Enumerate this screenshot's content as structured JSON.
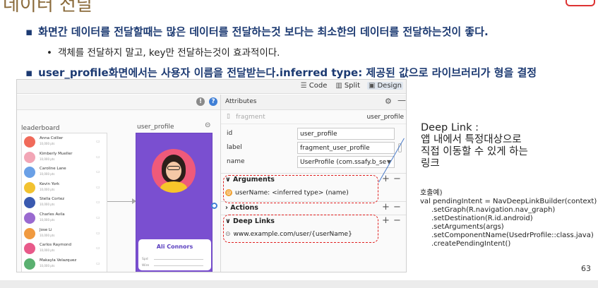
{
  "slide": {
    "title": "데이터 전달",
    "bullet1": "화면간 데이터를 전달할때는 많은 데이터를 전달하는것 보다는 최소한의 데이터를 전달하는것이 좋다.",
    "bullet2": "객체를 전달하지 말고, key만 전달하는것이 효과적이다.",
    "bullet3": "user_profile화면에서는 사용자 이름을 전달받는다.inferred type: 제공된 값으로 라이브러리가 형을 결정",
    "page_number": "63",
    "colors": {
      "heading": "#1c3a72",
      "title": "#8a6a3a",
      "highlight": "#e02020"
    }
  },
  "editor": {
    "modes": [
      "Code",
      "Split",
      "Design"
    ],
    "active_mode": "Design",
    "canvas": {
      "leaderboard_label": "leaderboard",
      "user_profile_label": "user_profile",
      "contacts": [
        {
          "name": "Anna Collier",
          "meta": "10,000 pts",
          "color": "#f06a5a"
        },
        {
          "name": "Kimberly Mueller",
          "meta": "10,000 pts",
          "color": "#f2a6b6"
        },
        {
          "name": "Caroline Lane",
          "meta": "10,000 pts",
          "color": "#6aa0e6"
        },
        {
          "name": "Kevin York",
          "meta": "10,000 pts",
          "color": "#f2c230"
        },
        {
          "name": "Stella Cortez",
          "meta": "10,000 pts",
          "color": "#3a5ab0"
        },
        {
          "name": "Charles Avila",
          "meta": "10,000 pts",
          "color": "#9a6ad0"
        },
        {
          "name": "Jose Li",
          "meta": "10,000 pts",
          "color": "#f09a40"
        },
        {
          "name": "Carlos Raymond",
          "meta": "10,000 pts",
          "color": "#e85a8a"
        },
        {
          "name": "Makayla Velazquez",
          "meta": "10,000 pts",
          "color": "#5ab070"
        }
      ],
      "profile_card": {
        "name": "Ali Connors",
        "row1": "Spd",
        "row2": "Wire"
      }
    },
    "attributes": {
      "panel_title": "Attributes",
      "fragment_label": "fragment",
      "fragment_id": "user_profile",
      "fields": [
        {
          "key": "id",
          "value": "user_profile"
        },
        {
          "key": "label",
          "value": "fragment_user_profile"
        },
        {
          "key": "name",
          "value": "UserProfile (com.ssafy.b_se"
        }
      ],
      "sections": {
        "arguments": "Arguments",
        "argument_item": "userName: <inferred type> (name)",
        "actions": "Actions",
        "deep_links": "Deep Links",
        "deep_link_item": "www.example.com/user/{userName}"
      }
    }
  },
  "notes": {
    "deep_link": [
      "Deep Link :",
      "앱 내에서 특정대상으로",
      "직접 이동할 수 있게 하는",
      "링크"
    ],
    "code": [
      "호출예)",
      "val pendingIntent = NavDeepLinkBuilder(context)",
      "    .setGraph(R.navigation.nav_graph)",
      "    .setDestination(R.id.android)",
      "    .setArguments(args)",
      "    .setComponentName(UsedrProfile::class.java)",
      "    .createPendingIntent()"
    ]
  }
}
